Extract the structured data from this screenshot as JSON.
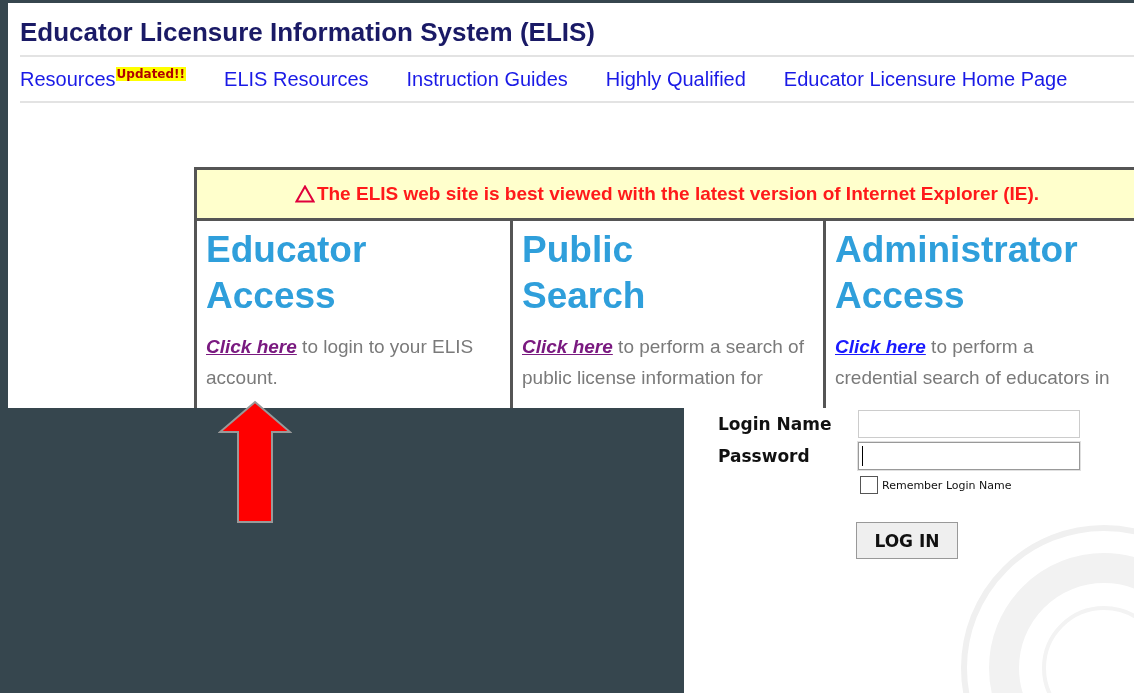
{
  "header": {
    "title": "Educator Licensure Information System (ELIS)"
  },
  "nav": [
    {
      "label": "Resources",
      "badge": "Updated!!"
    },
    {
      "label": "ELIS Resources"
    },
    {
      "label": "Instruction Guides"
    },
    {
      "label": "Highly Qualified"
    },
    {
      "label": "Educator Licensure Home Page"
    }
  ],
  "notice": {
    "text": "The ELIS web site is best viewed with the latest version of Internet Explorer (IE)."
  },
  "access_panels": [
    {
      "heading": "Educator Access",
      "link": "Click here",
      "visited": true,
      "text": "to login to your ELIS account."
    },
    {
      "heading": "Public Search",
      "link": "Click here",
      "visited": true,
      "text": "to perform a search of public license information for"
    },
    {
      "heading": "Administrator Access",
      "link": "Click here",
      "visited": false,
      "text": "to perform a credential search of educators in"
    }
  ],
  "login": {
    "fields": [
      {
        "label": "Login Name",
        "focused": false
      },
      {
        "label": "Password",
        "focused": true
      }
    ],
    "remember": {
      "label": "Remember Login Name",
      "checked": false
    },
    "button": "LOG IN"
  }
}
